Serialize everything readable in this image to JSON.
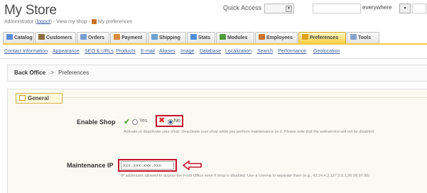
{
  "header": {
    "store_title": "My Store",
    "admin_prefix": "Administrator (",
    "logout": "logout",
    "admin_mid": ") - ",
    "view_shop": "View my shop",
    "admin_sep": " - ",
    "my_preferences": "My preferences",
    "quick_access": "Quick Access",
    "search_value": "",
    "search_scope": "everywhere"
  },
  "tabs": [
    {
      "label": "Catalog",
      "color": "#5b8ed8",
      "active": false
    },
    {
      "label": "Customers",
      "color": "#8a6d3b",
      "active": false
    },
    {
      "label": "Orders",
      "color": "#7b9ccf",
      "active": false
    },
    {
      "label": "Payment",
      "color": "#d98a3c",
      "active": false
    },
    {
      "label": "Shipping",
      "color": "#6aa0d0",
      "active": false
    },
    {
      "label": "Stats",
      "color": "#4d8fd6",
      "active": false
    },
    {
      "label": "Modules",
      "color": "#4e9a3c",
      "active": false
    },
    {
      "label": "Employees",
      "color": "#c8722a",
      "active": false
    },
    {
      "label": "Preferences",
      "color": "#e0a020",
      "active": true
    },
    {
      "label": "Tools",
      "color": "#8aa2c8",
      "active": false
    }
  ],
  "subtabs": [
    "Contact Information",
    "Appearance",
    "SEO & URLs",
    "Products",
    "E-mail",
    "Aliases",
    "Image",
    "Database",
    "Localization",
    "Search",
    "Performance",
    "Geolocation"
  ],
  "breadcrumb": {
    "back_office": "Back Office",
    "separator": ">",
    "current": "Preferences"
  },
  "section": {
    "legend": "General"
  },
  "enable_shop": {
    "label": "Enable Shop",
    "yes_label": "Yes",
    "no_label": "No",
    "selected": "No",
    "help": "Activate or deactivate your shop. Deactivate your shop while you perform maintenance on it. Please note that the webservice will not be disabled"
  },
  "maintenance_ip": {
    "label": "Maintenance IP",
    "value": "xxx.xxx.xxx.xxx",
    "help": "IP addresses allowed to access the Front Office even if shop is disabled. Use a comma to separate them (e.g., 42.24.4.2,127.0.0.1,99.98.97.96)"
  },
  "colors": {
    "highlight": "#c8102e",
    "active_tab": "#f6cf43",
    "link": "#3d5fa0"
  }
}
